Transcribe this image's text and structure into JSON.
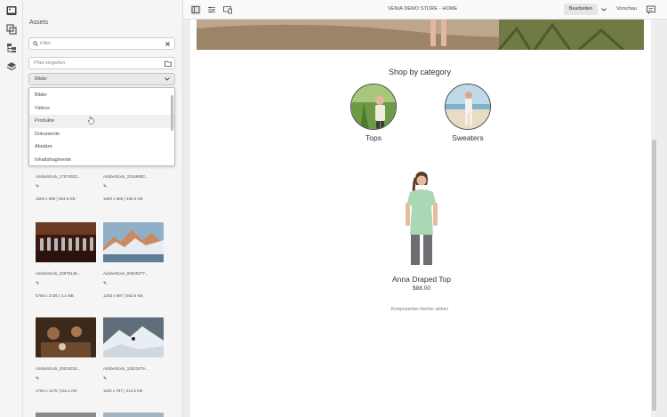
{
  "toolbar": {
    "page_title": "VENIA DEMO STORE - HOME",
    "edit_label": "Bearbeiten",
    "preview_label": "Vorschau"
  },
  "assets": {
    "title": "Assets",
    "filter_placeholder": "Filter",
    "path_placeholder": "Pfad eingeben",
    "type_selected": "Bilder",
    "type_options": [
      "Bilder",
      "Videos",
      "Produkte",
      "Dokumente",
      "Absätze",
      "Inhaltsfragmente"
    ],
    "items": [
      {
        "name": "AdobeStock_17574932...",
        "meta": "1600 x 999 | 594.5 KB"
      },
      {
        "name": "AdobeStock_23169883...",
        "meta": "1600 x 886 | 485.0 KB"
      },
      {
        "name": "AdobeStock_23975146...",
        "meta": "5760 x 2736 | 3.1 MB"
      },
      {
        "name": "AdobeStock_93049277...",
        "meta": "1345 x 897 | 563.6 KB"
      },
      {
        "name": "AdobeStock_20019234...",
        "meta": "1760 x 1175 | 511.1 KB"
      },
      {
        "name": "AdobeStock_10523479...",
        "meta": "1180 x 787 | 312.5 KB"
      }
    ]
  },
  "page": {
    "section_title": "Shop by category",
    "categories": [
      {
        "label": "Tops"
      },
      {
        "label": "Sweaters"
      }
    ],
    "product": {
      "name": "Anna Draped Top",
      "price": "$88.00"
    },
    "drop_hint": "Komponenten hierher ziehen"
  }
}
